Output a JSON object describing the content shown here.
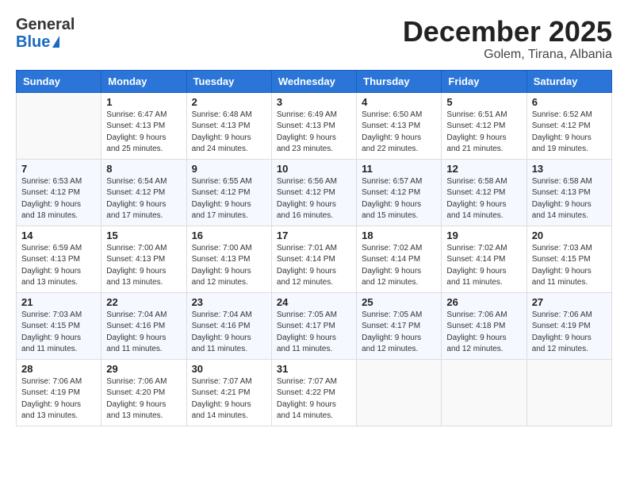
{
  "logo": {
    "general": "General",
    "blue": "Blue"
  },
  "title": "December 2025",
  "location": "Golem, Tirana, Albania",
  "days_of_week": [
    "Sunday",
    "Monday",
    "Tuesday",
    "Wednesday",
    "Thursday",
    "Friday",
    "Saturday"
  ],
  "weeks": [
    [
      {
        "day": "",
        "sunrise": "",
        "sunset": "",
        "daylight": ""
      },
      {
        "day": "1",
        "sunrise": "6:47 AM",
        "sunset": "4:13 PM",
        "daylight": "9 hours and 25 minutes."
      },
      {
        "day": "2",
        "sunrise": "6:48 AM",
        "sunset": "4:13 PM",
        "daylight": "9 hours and 24 minutes."
      },
      {
        "day": "3",
        "sunrise": "6:49 AM",
        "sunset": "4:13 PM",
        "daylight": "9 hours and 23 minutes."
      },
      {
        "day": "4",
        "sunrise": "6:50 AM",
        "sunset": "4:13 PM",
        "daylight": "9 hours and 22 minutes."
      },
      {
        "day": "5",
        "sunrise": "6:51 AM",
        "sunset": "4:12 PM",
        "daylight": "9 hours and 21 minutes."
      },
      {
        "day": "6",
        "sunrise": "6:52 AM",
        "sunset": "4:12 PM",
        "daylight": "9 hours and 19 minutes."
      }
    ],
    [
      {
        "day": "7",
        "sunrise": "6:53 AM",
        "sunset": "4:12 PM",
        "daylight": "9 hours and 18 minutes."
      },
      {
        "day": "8",
        "sunrise": "6:54 AM",
        "sunset": "4:12 PM",
        "daylight": "9 hours and 17 minutes."
      },
      {
        "day": "9",
        "sunrise": "6:55 AM",
        "sunset": "4:12 PM",
        "daylight": "9 hours and 17 minutes."
      },
      {
        "day": "10",
        "sunrise": "6:56 AM",
        "sunset": "4:12 PM",
        "daylight": "9 hours and 16 minutes."
      },
      {
        "day": "11",
        "sunrise": "6:57 AM",
        "sunset": "4:12 PM",
        "daylight": "9 hours and 15 minutes."
      },
      {
        "day": "12",
        "sunrise": "6:58 AM",
        "sunset": "4:12 PM",
        "daylight": "9 hours and 14 minutes."
      },
      {
        "day": "13",
        "sunrise": "6:58 AM",
        "sunset": "4:13 PM",
        "daylight": "9 hours and 14 minutes."
      }
    ],
    [
      {
        "day": "14",
        "sunrise": "6:59 AM",
        "sunset": "4:13 PM",
        "daylight": "9 hours and 13 minutes."
      },
      {
        "day": "15",
        "sunrise": "7:00 AM",
        "sunset": "4:13 PM",
        "daylight": "9 hours and 13 minutes."
      },
      {
        "day": "16",
        "sunrise": "7:00 AM",
        "sunset": "4:13 PM",
        "daylight": "9 hours and 12 minutes."
      },
      {
        "day": "17",
        "sunrise": "7:01 AM",
        "sunset": "4:14 PM",
        "daylight": "9 hours and 12 minutes."
      },
      {
        "day": "18",
        "sunrise": "7:02 AM",
        "sunset": "4:14 PM",
        "daylight": "9 hours and 12 minutes."
      },
      {
        "day": "19",
        "sunrise": "7:02 AM",
        "sunset": "4:14 PM",
        "daylight": "9 hours and 11 minutes."
      },
      {
        "day": "20",
        "sunrise": "7:03 AM",
        "sunset": "4:15 PM",
        "daylight": "9 hours and 11 minutes."
      }
    ],
    [
      {
        "day": "21",
        "sunrise": "7:03 AM",
        "sunset": "4:15 PM",
        "daylight": "9 hours and 11 minutes."
      },
      {
        "day": "22",
        "sunrise": "7:04 AM",
        "sunset": "4:16 PM",
        "daylight": "9 hours and 11 minutes."
      },
      {
        "day": "23",
        "sunrise": "7:04 AM",
        "sunset": "4:16 PM",
        "daylight": "9 hours and 11 minutes."
      },
      {
        "day": "24",
        "sunrise": "7:05 AM",
        "sunset": "4:17 PM",
        "daylight": "9 hours and 11 minutes."
      },
      {
        "day": "25",
        "sunrise": "7:05 AM",
        "sunset": "4:17 PM",
        "daylight": "9 hours and 12 minutes."
      },
      {
        "day": "26",
        "sunrise": "7:06 AM",
        "sunset": "4:18 PM",
        "daylight": "9 hours and 12 minutes."
      },
      {
        "day": "27",
        "sunrise": "7:06 AM",
        "sunset": "4:19 PM",
        "daylight": "9 hours and 12 minutes."
      }
    ],
    [
      {
        "day": "28",
        "sunrise": "7:06 AM",
        "sunset": "4:19 PM",
        "daylight": "9 hours and 13 minutes."
      },
      {
        "day": "29",
        "sunrise": "7:06 AM",
        "sunset": "4:20 PM",
        "daylight": "9 hours and 13 minutes."
      },
      {
        "day": "30",
        "sunrise": "7:07 AM",
        "sunset": "4:21 PM",
        "daylight": "9 hours and 14 minutes."
      },
      {
        "day": "31",
        "sunrise": "7:07 AM",
        "sunset": "4:22 PM",
        "daylight": "9 hours and 14 minutes."
      },
      {
        "day": "",
        "sunrise": "",
        "sunset": "",
        "daylight": ""
      },
      {
        "day": "",
        "sunrise": "",
        "sunset": "",
        "daylight": ""
      },
      {
        "day": "",
        "sunrise": "",
        "sunset": "",
        "daylight": ""
      }
    ]
  ],
  "labels": {
    "sunrise": "Sunrise:",
    "sunset": "Sunset:",
    "daylight": "Daylight:"
  }
}
